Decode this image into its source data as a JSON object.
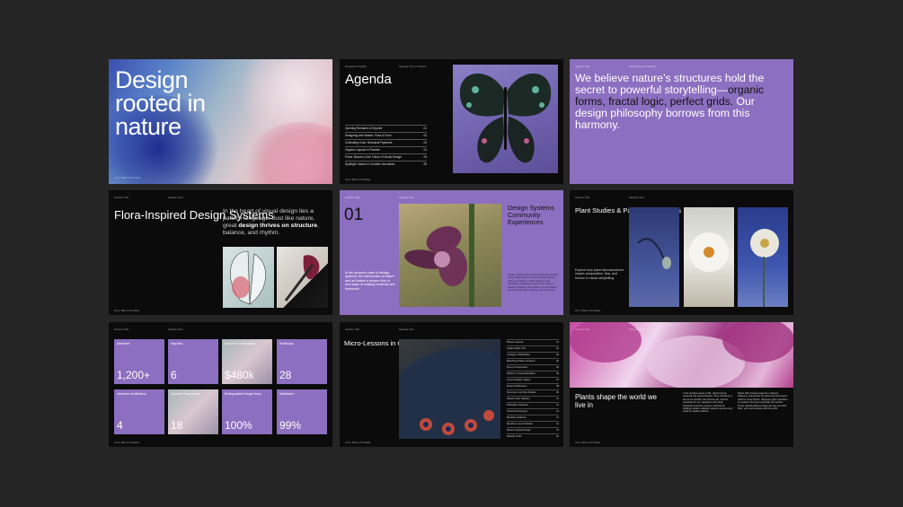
{
  "s1": {
    "title_lines": [
      "Design",
      "rooted in",
      "nature"
    ],
    "footer": "Art in Bloom Portfolio"
  },
  "s2": {
    "header_left": "Research Insights",
    "header_right": "Sample Text in Section",
    "title": "Agenda",
    "items": [
      {
        "label": "Opening Remarks & Keynote",
        "num": "01"
      },
      {
        "label": "Designing with Nature: Flora & Form",
        "num": "02"
      },
      {
        "label": "Cultivating Color: Botanical Pigments",
        "num": "03"
      },
      {
        "label": "Organic Layouts in Practice",
        "num": "04"
      },
      {
        "label": "Panel: Blooms & the Future of Visual Design",
        "num": "05"
      },
      {
        "label": "Spotlight: Nature in Creative Innovation",
        "num": "06"
      }
    ],
    "footer": "Art in Bloom Portfolio"
  },
  "s3": {
    "header_left": "Section Title",
    "header_right": "Sample Text in Section",
    "quote_a": "We believe nature’s structures hold the secret to powerful storytelling—",
    "quote_b": "organic forms, fractal logic, perfect grids.",
    "quote_c": " Our design philosophy borrows from this harmony."
  },
  "s4": {
    "header_left": "Section Title",
    "header_right": "Sample Text",
    "title": "Flora-Inspired Design Systems",
    "para_a": "In the heart of visual design lies a pattern language. Just like nature, great ",
    "para_b": "design thrives on structure",
    "para_c": ", balance, and rhythm.",
    "footer": "Art in Bloom Portfolio"
  },
  "s5": {
    "header_left": "Section Title",
    "header_right": "Sample Text",
    "number": "01",
    "heading": "Design Systems Community Experiences",
    "body": "In the dynamic realm of design, systems, the intersection of nature and art fosters a deeper dive of new ways of unifying creativity and teamwork.",
    "body2": "Design systems often evolve organically, shaped by the relationships that grow between people, ideas, and patterns. When designers and developers collaborate openly, they create a shared vocabulary that becomes the foundation for meaningful work, learning, and connection."
  },
  "s6": {
    "header_left": "Section Title",
    "header_right": "Sample Text",
    "title": "Plant Studies & Pattern References",
    "para": "Explore how plant microstructures inspire composition, flow, and texture in visual storytelling.",
    "footer": "Art in Bloom Portfolio"
  },
  "s7": {
    "header_left": "Section Title",
    "header_right": "Sample Text",
    "cards": [
      {
        "label": "Attendees",
        "value": "1,200+"
      },
      {
        "label": "Keynotes",
        "value": "6"
      },
      {
        "label": "Raised for Conservation",
        "value": "$480k"
      },
      {
        "label": "Workshops",
        "value": "28"
      },
      {
        "label": "Interactive Installations",
        "value": "4"
      },
      {
        "label": "Countries Represented",
        "value": "18"
      },
      {
        "label": "Biodegradable Design Setup",
        "value": "100%"
      },
      {
        "label": "Satisfaction",
        "value": "99%"
      }
    ],
    "footer": "Art in Bloom Portfolio"
  },
  "s8": {
    "header_left": "Section Title",
    "header_right": "Sample Text",
    "title": "Micro-Lessons in Organic Design",
    "lessons": [
      {
        "label": "Botanic Layouts",
        "num": "01"
      },
      {
        "label": "Golden Ratio Grid",
        "num": "02"
      },
      {
        "label": "Lineages of Butterflies",
        "num": "03"
      },
      {
        "label": "Branching Pattern Systems",
        "num": "04"
      },
      {
        "label": "Flow of Composition",
        "num": "05"
      },
      {
        "label": "Rhythm in Visual Repetition",
        "num": "06"
      },
      {
        "label": "Communication Nature",
        "num": "07"
      },
      {
        "label": "Botanic Reflections",
        "num": "08"
      },
      {
        "label": "Symmetry and Flow Studies",
        "num": "09"
      },
      {
        "label": "Natural Color Palettes",
        "num": "10"
      },
      {
        "label": "Pollination Interfaces",
        "num": "11"
      },
      {
        "label": "Textural Prototyping",
        "num": "12"
      },
      {
        "label": "Butterfly Gradients",
        "num": "13"
      },
      {
        "label": "Mycelium Layout Studies",
        "num": "14"
      },
      {
        "label": "Nature-Inspired Design",
        "num": "15"
      },
      {
        "label": "Butterfly Grids",
        "num": "16"
      }
    ],
    "footer": "Art in Bloom Portfolio"
  },
  "s9": {
    "header_left": "Section Title",
    "header_right": "Sample Text",
    "title": "Plants shape the world we live in",
    "para1": "In the intricate weave of life, plants hold an essential role beyond beauty. They contribute to the air we breathe, the food we eat, and the materials we use. Designers who study botanical structures uncover methods for building resilient, adaptive systems across every scale of creative practice.",
    "para2": "Plants offer timeless lessons in balance, efficiency, and growth. By observing how leaves unfurl or roots branch, designers gain inspiration for systems that grow gracefully and endure. These natural patterns shape the way we build, think, and communicate with the world.",
    "footer": "Art in Bloom Portfolio"
  }
}
